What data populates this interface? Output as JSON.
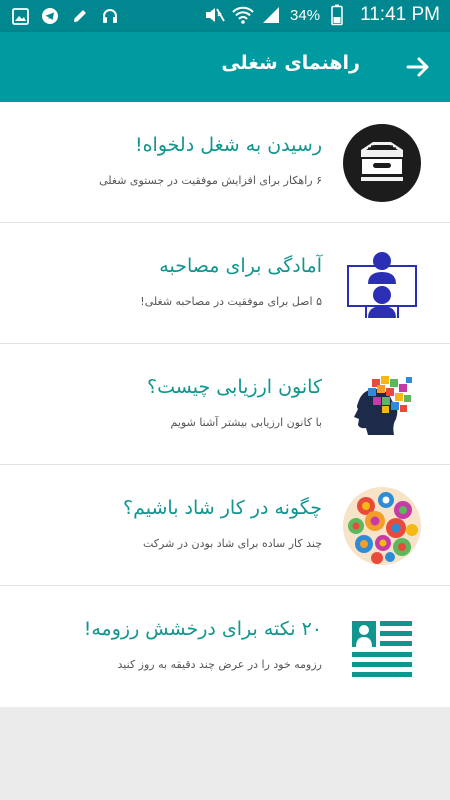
{
  "status_bar": {
    "battery_percent": "34%",
    "time": "11:41 PM",
    "left_icons": [
      "image-icon",
      "telegram-icon",
      "pencil-icon",
      "headphones-icon"
    ],
    "right_icons": [
      "mute-icon",
      "wifi-icon",
      "signal-icon",
      "battery-icon"
    ]
  },
  "app_bar": {
    "title": "راهنمای شغلی",
    "back_icon": "arrow-right-icon"
  },
  "items": [
    {
      "title": "رسیدن به شغل دلخواه!",
      "subtitle": "۶ راهکار برای افزایش موفقیت در جستوی شغلی",
      "icon": "file-drawer-icon"
    },
    {
      "title": "آمادگی برای مصاحبه",
      "subtitle": "۵ اصل  برای موفقیت در مصاحبه شغلی!",
      "icon": "interview-icon"
    },
    {
      "title": "کانون ارزیابی چیست؟",
      "subtitle": "با کانون ارزیابی بیشتر آشنا شویم",
      "icon": "brain-puzzle-icon"
    },
    {
      "title": "چگونه در کار شاد باشیم؟",
      "subtitle": "چند کار ساده برای شاد بودن در شرکت",
      "icon": "colorful-circle-icon"
    },
    {
      "title": "۲۰ نکته برای درخشش رزومه!",
      "subtitle": "رزومه خود را  در عرض چند دقیقه به روز کنید",
      "icon": "resume-icon"
    }
  ],
  "colors": {
    "status_bar": "#00878f",
    "app_bar": "#009aa1",
    "title_text": "#11958f",
    "background": "#ebebeb"
  }
}
